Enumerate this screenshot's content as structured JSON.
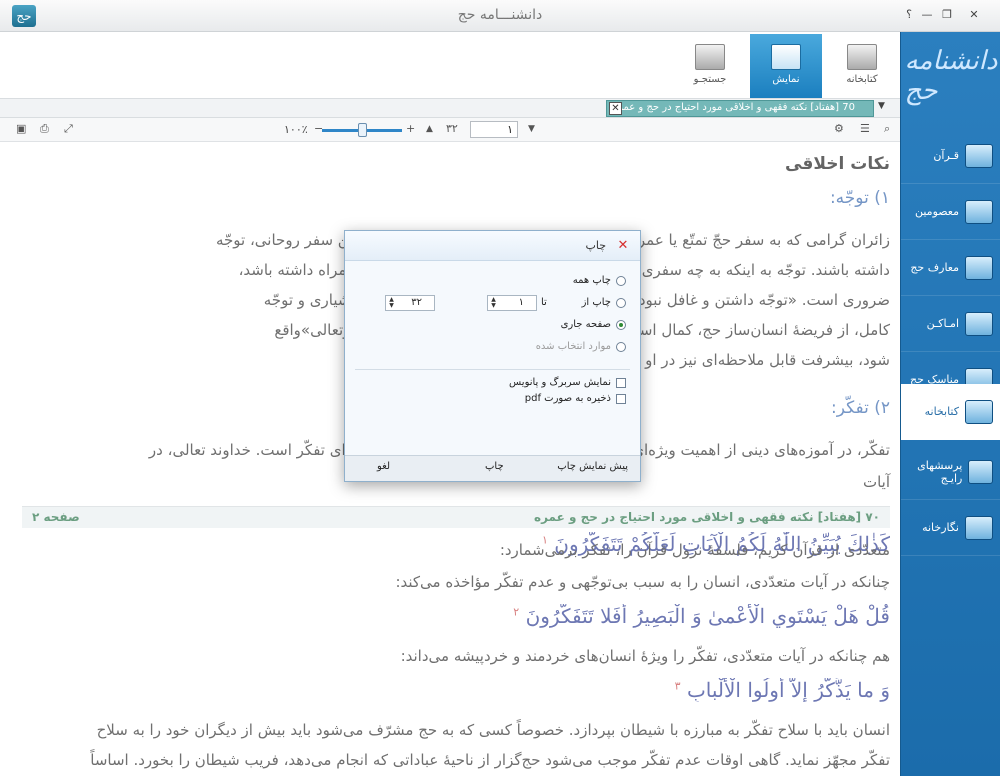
{
  "window": {
    "title": "دانشنـــامه حج",
    "logo_glyph": "حج",
    "controls": [
      "؟",
      "—",
      "❐",
      "✕"
    ]
  },
  "sidebar": {
    "brand": "دانشنامه حج",
    "items": [
      {
        "label": "قـرآن",
        "icon": "quran-icon",
        "active": false
      },
      {
        "label": "معصومین",
        "icon": "masumin-icon",
        "active": false
      },
      {
        "label": "معارف حج",
        "icon": "knowledge-icon",
        "active": false
      },
      {
        "label": "امـاکـن",
        "icon": "places-icon",
        "active": false
      },
      {
        "label": "مناسک حج",
        "icon": "rituals-icon",
        "active": false
      },
      {
        "label": "کتابخانه",
        "icon": "library-icon",
        "active": true
      },
      {
        "label": "پرسشهای رایـج",
        "icon": "faq-icon",
        "active": false
      },
      {
        "label": "نگارخانه",
        "icon": "gallery-icon",
        "active": false
      }
    ]
  },
  "ribbon": {
    "tabs": [
      {
        "label": "کتابخانه",
        "icon": "books-icon",
        "active": false
      },
      {
        "label": "نمایش",
        "icon": "view-icon",
        "active": true
      },
      {
        "label": "جستجـو",
        "icon": "magnifier-icon",
        "active": false
      }
    ]
  },
  "doc_tab": {
    "label": "70 [هفتاد] نکته فقهی و اخلاقی مورد احتیاج در حج و عمره",
    "close": "✕",
    "dropdown": "▼"
  },
  "toolbar": {
    "zoom": "۱۰۰٪",
    "zoom_minus": "−",
    "zoom_plus": "+",
    "zoom_level": 0.5,
    "page_current": "۱",
    "page_total": "۳۲",
    "up": "▲",
    "down": "▼",
    "search_glyph": "⌕",
    "settings_glyph": "⚙",
    "list_glyph": "☰",
    "print_glyph": "⎙",
    "fullscreen_glyph": "⤢",
    "save_glyph": "▣"
  },
  "content": {
    "heading": "نکات اخلاقی",
    "section1": "۱) توجّه:",
    "para1_line1": "زائران گرامی که به سفر حجّ تمتّع یا عمره مشرّف می‌شوند، باید به عظمت و معنویت این سفر روحانی، توجّه",
    "para1_line2": "داشته باشند. توجّه به اینکه به چه سفری می‌روند و چه فوائدی را می‌تواند برای آنان به همراه داشته باشد،",
    "para1_line3": "ضروری است. «توجّه داشتن و غافل نبودن» است؛ به این ترتیب زائر خانهٔ خدا باید با هوشیاری و توجّه",
    "para1_line4": "کامل، از فریضهٔ انسان‌ساز حج، کمال استفاده را ببرد تا مورد پذیرش حضرت حق«تبارك‌وتعالی»واقع",
    "para1_line5": "شود، بیشرفت قابل ملاحظه‌ای نیز در او ایجاد گردد.",
    "section2": "۲) تفکّر:",
    "para2_line1": "تفکّر، در آموزه‌های دینی از اهمیت ویژه‌ای برخوردار است و حج فرصت بسیار مناسبی برای تفکّر است. خداوند تعالی، در",
    "para2_line2": "آیات",
    "page_sep_title": "۷۰ [هفتاد] نکته فقهی و اخلاقی مورد احتیاج در حج و عمره",
    "page_sep_page": "صفحه ۲",
    "para3": "متعدّدی از قرآن کریم، فلسفهٔ نزول قرآن را، تفکر برمی‌شمارد:",
    "aya1": "كَذٰلِكَ يُبَيِّنُ اللّٰهُ لَكُمُ الْآيَاتِ لَعَلَّكُمْ تَتَفَكَّرُونَ",
    "aya1_ref": "۱",
    "para4": "چنانکه در آیات متعدّدی، انسان را به سبب بی‌توجّهی و عدم تفکّر مؤاخذه می‌کند:",
    "aya2": "قُلْ هَلْ يَسْتَوِي الْأَعْمىٰ وَ الْبَصِيرُ أَفَلا تَتَفَكَّرُونَ",
    "aya2_ref": "۲",
    "para5": "هم چنانکه در آیات متعدّدی، تفکّر را ویژهٔ انسان‌های خردمند و خردپیشه می‌داند:",
    "aya3": "وَ ما يَذَّكَّرُ إِلاَّ أُولُوا الْأَلْبابِ",
    "aya3_ref": "۳",
    "para6_line1": "انسان باید با سلاح تفکّر به مبارزه با شیطان بپردازد. خصوصاً کسی که به حج مشرّف می‌شود باید بیش از دیگران خود را به سلاح",
    "para6_line2": "تفکّر مجهّز نماید. گاهی اوقات عدم تفکّر موجب می‌شود حج‌گزار از ناحیهٔ عباداتی که انجام می‌دهد، فریب شیطان را بخورد. اساساً"
  },
  "dialog": {
    "title": "چاپ",
    "close": "✕",
    "print_all": "چاپ همه",
    "print_from": "چاپ از",
    "from_value": "۱",
    "to_label": "تا",
    "to_value": "۳۲",
    "current_page": "صفحه جاری",
    "selected_items": "موارد انتخاب شده",
    "show_header_footer": "نمایش سربرگ و پانویس",
    "save_pdf": "ذخیره به صورت pdf",
    "preview_button": "پیش نمایش چاپ",
    "print_button": "چاپ",
    "cancel_button": "لغو",
    "selected_option": "current_page"
  }
}
